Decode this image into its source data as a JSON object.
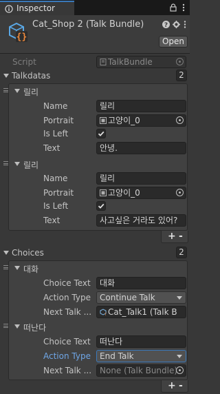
{
  "tab": {
    "title": "Inspector",
    "icon": "info-icon",
    "tools": {
      "lock": "lock-icon",
      "menu": "more-vertical-icon"
    }
  },
  "header": {
    "title": "Cat_Shop 2 (Talk Bundle)",
    "icon": "scriptable-object-icon",
    "help_icon": "help-icon",
    "settings_icon": "settings-icon",
    "menu_icon": "more-vertical-icon",
    "open_label": "Open"
  },
  "script": {
    "label": "Script",
    "value": "TalkBundle"
  },
  "talkdatas": {
    "label": "Talkdatas",
    "count": "2",
    "items": [
      {
        "title": "릴리",
        "name_label": "Name",
        "name": "릴리",
        "portrait_label": "Portrait",
        "portrait": "고양이_0",
        "isleft_label": "Is Left",
        "isleft": true,
        "text_label": "Text",
        "text": "안녕."
      },
      {
        "title": "릴리",
        "name_label": "Name",
        "name": "릴리",
        "portrait_label": "Portrait",
        "portrait": "고양이_0",
        "isleft_label": "Is Left",
        "isleft": true,
        "text_label": "Text",
        "text": "사고싶은 거라도 있어?"
      }
    ],
    "add": "+",
    "remove": "-"
  },
  "choices": {
    "label": "Choices",
    "count": "2",
    "items": [
      {
        "title": "대화",
        "choice_text_label": "Choice Text",
        "choice_text": "대화",
        "action_type_label": "Action Type",
        "action_type": "Continue Talk",
        "next_talk_label": "Next Talk ...",
        "next_talk": "Cat_Talk1 (Talk B"
      },
      {
        "title": "떠난다",
        "choice_text_label": "Choice Text",
        "choice_text": "떠난다",
        "action_type_label": "Action Type",
        "action_type": "End Talk",
        "next_talk_label": "Next Talk ...",
        "next_talk": "None (Talk Bundle)"
      }
    ],
    "add": "+",
    "remove": "-"
  },
  "colors": {
    "accent": "#3a79bb",
    "background": "#383838",
    "field": "#2a2a2a",
    "selected_label": "#6fa6e6"
  }
}
